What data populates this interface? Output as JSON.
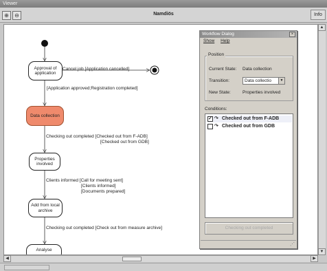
{
  "window": {
    "title": "Viewer",
    "doc_title": "Namdiös"
  },
  "toolbar": {
    "zoom_in_icon": "zoom-in-icon",
    "zoom_out_icon": "zoom-out-icon",
    "info_label": "Info"
  },
  "diagram": {
    "states": [
      {
        "id": "approval",
        "label": "Approval of application"
      },
      {
        "id": "data",
        "label": "Data collection"
      },
      {
        "id": "properties",
        "label": "Properties involved"
      },
      {
        "id": "add",
        "label": "Add from local archive"
      },
      {
        "id": "analyse",
        "label": "Analyse"
      }
    ],
    "transitions": {
      "cancel": "Cancel job [Application cancelled]",
      "approved": "[Application approved;Registration completed]",
      "checkout1_a": "Checking out completed [Checked out from F-ADB]",
      "checkout1_b": "[Checked out from GDB]",
      "clients_a": "Clients informed [Call for meeting sent]",
      "clients_b": "[Clients informed]",
      "clients_c": "[Documents prepared]",
      "checkout2": "Checking out completed [Check out from measure archive]"
    },
    "colors": {
      "active_state": "#ef8a6c"
    }
  },
  "dialog": {
    "title": "Workflow Dialog",
    "menu": [
      "Show",
      "Help"
    ],
    "position_label": "Position",
    "current_state_label": "Current State:",
    "current_state_value": "Data collection",
    "transition_label": "Transition:",
    "transition_value": "Data collectio",
    "new_state_label": "New State:",
    "new_state_value": "Properties involved",
    "conditions_label": "Conditions:",
    "conditions": [
      {
        "label": "Checked out from F-ADB",
        "checked": true
      },
      {
        "label": "Checked out from GDB",
        "checked": false
      }
    ],
    "button_label": "Checking out completed"
  }
}
